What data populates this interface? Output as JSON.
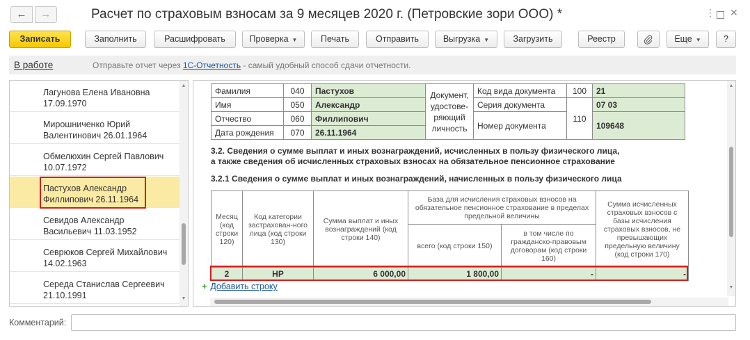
{
  "window": {
    "title": "Расчет по страховым взносам за 9 месяцев 2020 г. (Петровские зори ООО) *",
    "back_icon": "arrow-left",
    "forward_icon": "arrow-right"
  },
  "toolbar": {
    "save": "Записать",
    "fill": "Заполнить",
    "decode": "Расшифровать",
    "check": "Проверка",
    "print": "Печать",
    "send": "Отправить",
    "export": "Выгрузка",
    "load": "Загрузить",
    "registry": "Реестр",
    "more": "Еще",
    "help": "?"
  },
  "infobar": {
    "status_link": "В работе",
    "text_before": "Отправьте отчет через ",
    "link": "1С-Отчетность",
    "text_after": " - самый удобный способ сдачи отчетности."
  },
  "persons": [
    {
      "line1": "Лагунова Елена Ивановна",
      "line2": "17.09.1970"
    },
    {
      "line1": "Мирошниченко Юрий",
      "line2": "Валентинович 26.01.1964"
    },
    {
      "line1": "Обмелюхин Сергей Павлович",
      "line2": "10.07.1972"
    },
    {
      "line1": "Пастухов Александр",
      "line2": "Филлипович 26.11.1964"
    },
    {
      "line1": "Севидов Александр",
      "line2": "Васильевич 11.03.1952"
    },
    {
      "line1": "Севрюков Сергей Михайлович",
      "line2": "14.02.1963"
    },
    {
      "line1": "Середа Станислав Сергеевич",
      "line2": "21.10.1991"
    }
  ],
  "personal": {
    "surname": {
      "label": "Фамилия",
      "code": "040",
      "value": "Пастухов"
    },
    "name": {
      "label": "Имя",
      "code": "050",
      "value": "Александр"
    },
    "patronymic": {
      "label": "Отчество",
      "code": "060",
      "value": "Филлипович"
    },
    "birthdate": {
      "label": "Дата рождения",
      "code": "070",
      "value": "26.11.1964"
    },
    "doc_label": "Документ, удостове-ряющий личность",
    "doc_type": {
      "label": "Код вида документа",
      "code": "100",
      "value": "21"
    },
    "doc_series": {
      "label": "Серия документа",
      "value": "07 03"
    },
    "doc_number": {
      "label": "Номер документа",
      "code": "110",
      "value": "109648"
    }
  },
  "section32": {
    "line1": "3.2. Сведения о сумме выплат и иных вознаграждений, исчисленных в пользу физического лица,",
    "line2": "а также сведения об исчисленных страховых взносах на обязательное пенсионное страхование"
  },
  "section321": {
    "title": "3.2.1 Сведения о сумме выплат и иных вознаграждений, начисленных в пользу физического лица"
  },
  "table": {
    "h_month": "Месяц (код строки 120)",
    "h_category": "Код категории застрахован-ного лица (код строки 130)",
    "h_sum": "Сумма выплат и иных вознаграждений (код строки 140)",
    "h_base": "База для исчисления страховых взносов на обязательное пенсионное страхование в пределах предельной величины",
    "h_total": "всего (код строки 150)",
    "h_civil": "в том числе по гражданско-правовым договорам (код строки 160)",
    "h_contrib": "Сумма исчисленных страховых взносов с базы исчисления страховых взносов, не превышающих предельную величину (код строки 170)",
    "row": {
      "month": "2",
      "category": "НР",
      "sum": "6 000,00",
      "total": "1 800,00",
      "civil": "-",
      "contrib": "-"
    }
  },
  "add_row": "Добавить строку",
  "comment_label": "Комментарий:",
  "colors": {
    "primary": "#f5c900",
    "highlight": "#fbeaa3",
    "cell": "#dcebd3",
    "mark": "#d21e1e",
    "link": "#1b56a0"
  }
}
